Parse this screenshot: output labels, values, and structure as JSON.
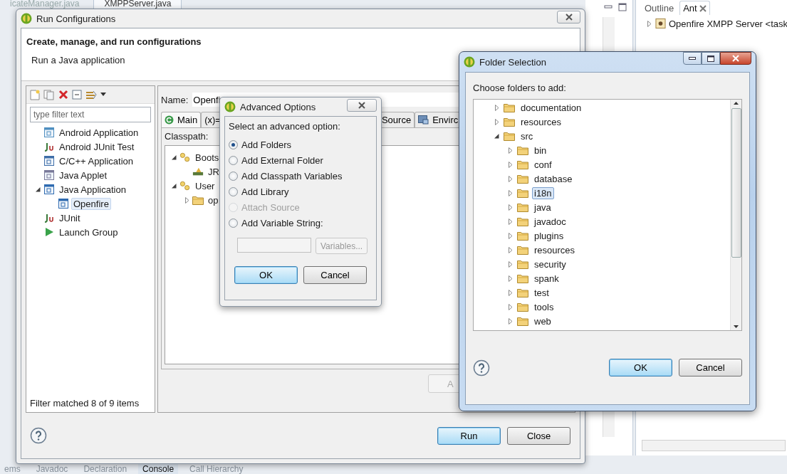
{
  "editor_tabs": [
    {
      "label": "icateManager.java",
      "selected": false
    },
    {
      "label": "XMPPServer.java",
      "selected": true
    }
  ],
  "side_view": {
    "tabs": [
      {
        "label": "Outline",
        "selected": false
      },
      {
        "label": "Ant",
        "selected": true
      }
    ],
    "tree": [
      {
        "label": "Openfire XMPP Server <task",
        "expanded": false
      }
    ]
  },
  "bottom_tabs": [
    {
      "label": "ems",
      "selected": false
    },
    {
      "label": "Javadoc",
      "selected": false
    },
    {
      "label": "Declaration",
      "selected": false
    },
    {
      "label": "Console",
      "selected": true
    },
    {
      "label": "Call Hierarchy",
      "selected": false
    }
  ],
  "run_dialog": {
    "title": "Run Configurations",
    "heading": "Create, manage, and run configurations",
    "subheading": "Run a Java application",
    "filter": {
      "placeholder": "type filter text"
    },
    "configs": [
      {
        "label": "Android Application",
        "kind": "android",
        "selected": false
      },
      {
        "label": "Android JUnit Test",
        "kind": "junit",
        "selected": false
      },
      {
        "label": "C/C++ Application",
        "kind": "cpp",
        "selected": false
      },
      {
        "label": "Java Applet",
        "kind": "applet",
        "selected": false
      },
      {
        "label": "Java Application",
        "kind": "java",
        "selected": false,
        "expanded": true,
        "children": [
          {
            "label": "Openfire",
            "kind": "java",
            "selected": true
          }
        ]
      },
      {
        "label": "JUnit",
        "kind": "junit",
        "selected": false
      },
      {
        "label": "Launch Group",
        "kind": "launch",
        "selected": false
      }
    ],
    "filter_status": "Filter matched 8 of 9 items",
    "name_label": "Name:",
    "name_value": "Openfi",
    "tabs": [
      {
        "label": "Main",
        "selected": true
      },
      {
        "label": "(x)=",
        "selected": false
      },
      {
        "label": "Source",
        "selected": false
      },
      {
        "label": "Envirc",
        "selected": false
      }
    ],
    "classpath_label": "Classpath:",
    "classpath": [
      {
        "label": "Boots",
        "expanded": true,
        "children": [
          {
            "label": "JR"
          }
        ]
      },
      {
        "label": "User",
        "expanded": true,
        "children": [
          {
            "label": "op",
            "expanded": false
          }
        ]
      }
    ],
    "apply_button": "A",
    "buttons": [
      {
        "label": "Run",
        "default": true
      },
      {
        "label": "Close",
        "default": false
      }
    ]
  },
  "advanced_dialog": {
    "title": "Advanced Options",
    "prompt": "Select an advanced option:",
    "options": [
      {
        "label": "Add Folders",
        "selected": true,
        "disabled": false
      },
      {
        "label": "Add External Folder",
        "selected": false,
        "disabled": false
      },
      {
        "label": "Add Classpath Variables",
        "selected": false,
        "disabled": false
      },
      {
        "label": "Add Library",
        "selected": false,
        "disabled": false
      },
      {
        "label": "Attach Source",
        "selected": false,
        "disabled": true
      },
      {
        "label": "Add Variable String:",
        "selected": false,
        "disabled": false
      }
    ],
    "variables_button": {
      "label": "Variables...",
      "disabled": true
    },
    "buttons": [
      {
        "label": "OK",
        "default": true
      },
      {
        "label": "Cancel",
        "default": false
      }
    ]
  },
  "folder_dialog": {
    "title": "Folder Selection",
    "prompt": "Choose folders to add:",
    "tree": [
      {
        "label": "documentation",
        "expanded": false,
        "selected": false
      },
      {
        "label": "resources",
        "expanded": false,
        "selected": false
      },
      {
        "label": "src",
        "expanded": true,
        "selected": false,
        "children": [
          {
            "label": "bin",
            "expanded": false,
            "selected": false
          },
          {
            "label": "conf",
            "expanded": false,
            "selected": false
          },
          {
            "label": "database",
            "expanded": false,
            "selected": false
          },
          {
            "label": "i18n",
            "expanded": false,
            "selected": true
          },
          {
            "label": "java",
            "expanded": false,
            "selected": false
          },
          {
            "label": "javadoc",
            "expanded": false,
            "selected": false
          },
          {
            "label": "plugins",
            "expanded": false,
            "selected": false
          },
          {
            "label": "resources",
            "expanded": false,
            "selected": false
          },
          {
            "label": "security",
            "expanded": false,
            "selected": false
          },
          {
            "label": "spank",
            "expanded": false,
            "selected": false
          },
          {
            "label": "test",
            "expanded": false,
            "selected": false
          },
          {
            "label": "tools",
            "expanded": false,
            "selected": false
          },
          {
            "label": "web",
            "expanded": false,
            "selected": false
          }
        ]
      }
    ],
    "buttons": [
      {
        "label": "OK",
        "default": true
      },
      {
        "label": "Cancel",
        "default": false
      }
    ]
  }
}
